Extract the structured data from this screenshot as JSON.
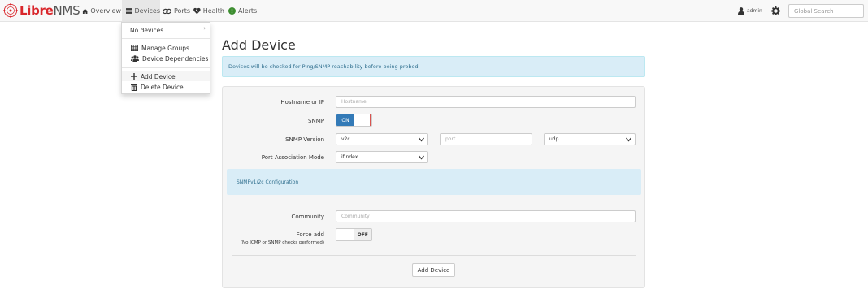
{
  "brand": {
    "part1": "Libre",
    "part2": "NMS",
    "color_red": "#d9262b"
  },
  "nav": {
    "overview": "Overview",
    "devices": "Devices",
    "ports": "Ports",
    "health": "Health",
    "alerts": "Alerts",
    "user": "admin",
    "search_placeholder": "Global Search"
  },
  "devices_menu": {
    "no_devices": "No devices",
    "manage_groups": "Manage Groups",
    "device_dependencies": "Device Dependencies",
    "add_device": "Add Device",
    "delete_device": "Delete Device"
  },
  "page": {
    "title": "Add Device",
    "info": "Devices will be checked for Ping/SNMP reachability before being probed."
  },
  "form": {
    "hostname_label": "Hostname or IP",
    "hostname_placeholder": "Hostname",
    "snmp_label": "SNMP",
    "snmp_toggle": "ON",
    "snmp_version_label": "SNMP Version",
    "snmp_version_value": "v2c",
    "port_placeholder": "port",
    "transport_value": "udp",
    "port_assoc_label": "Port Association Mode",
    "port_assoc_value": "ifIndex",
    "snmp_config_heading": "SNMPv1/2c Configuration",
    "community_label": "Community",
    "community_placeholder": "Community",
    "force_add_label": "Force add",
    "force_add_sub": "(No ICMP or SNMP checks performed)",
    "force_add_toggle": "OFF",
    "submit": "Add Device"
  },
  "colors": {
    "primary": "#337ab7",
    "info_bg": "#d9edf7",
    "info_text": "#31708f"
  }
}
